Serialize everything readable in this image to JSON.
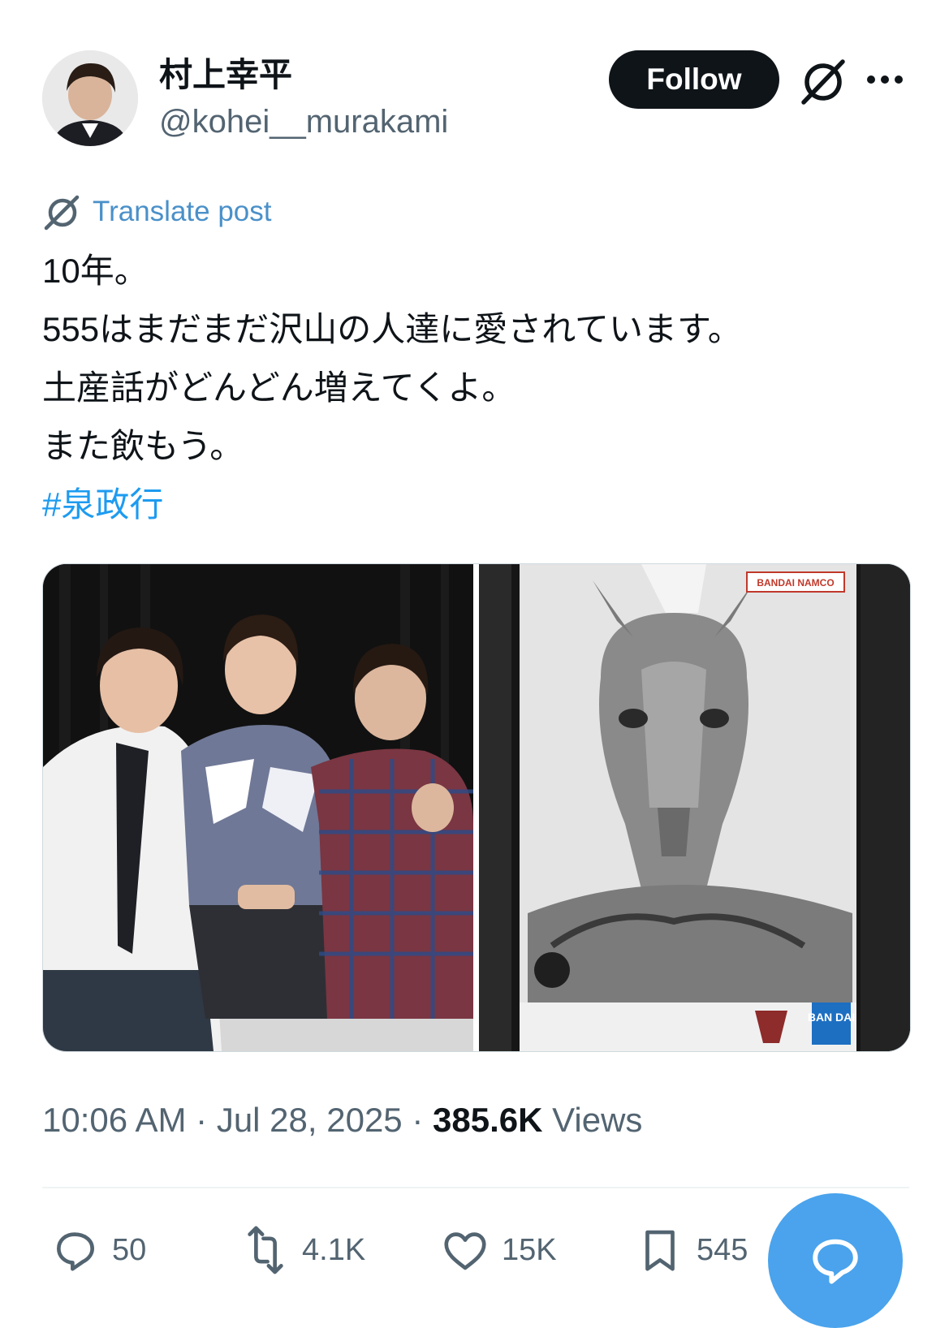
{
  "author": {
    "display_name": "村上幸平",
    "handle": "@kohei__murakami",
    "avatar_icon": "profile-photo"
  },
  "header": {
    "follow_label": "Follow",
    "grok_icon": "grok-icon",
    "more_icon": "more-dots-icon"
  },
  "translate": {
    "label": "Translate post",
    "icon": "grok-icon"
  },
  "tweet": {
    "lines": [
      "10年。",
      "555はまだまだ沢山の人達に愛されています。",
      "土産話がどんどん増えてくよ。",
      "また飲もう。"
    ],
    "hashtag": "#泉政行"
  },
  "media": {
    "left_image": "photo-three-men",
    "right_image": "figure-box-horse-mask",
    "right_brand_text": "BANDAI NAMCO",
    "right_logo_text": "BAN DAI"
  },
  "meta": {
    "time": "10:06 AM",
    "date": "Jul 28, 2025",
    "views_count": "385.6K",
    "views_label": "Views",
    "separator": "·"
  },
  "actions": {
    "replies": "50",
    "reposts": "4.1K",
    "likes": "15K",
    "bookmarks": "545"
  },
  "colors": {
    "link_blue": "#1d9bf0",
    "translate_blue": "#4a90c9",
    "fab_blue": "#4aa3ec",
    "muted_gray": "#536471",
    "text_black": "#0f1419"
  }
}
